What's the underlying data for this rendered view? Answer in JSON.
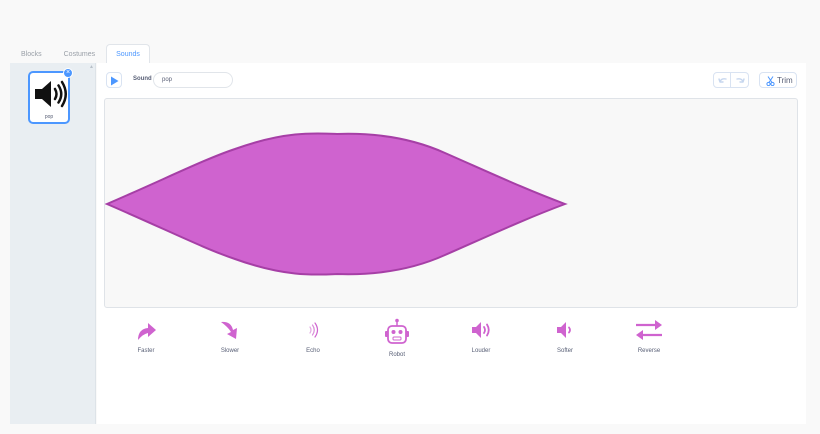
{
  "tabs": [
    {
      "label": "Blocks"
    },
    {
      "label": "Costumes"
    },
    {
      "label": "Sounds",
      "active": true
    }
  ],
  "sound_list": {
    "items": [
      {
        "label": "pop",
        "icon": "speaker-icon",
        "selected": true
      }
    ],
    "delete_badge": "×"
  },
  "editor": {
    "sound_label": "Sound",
    "sound_name": "pop",
    "trim_label": "Trim",
    "waveform_color": "#cf63cf",
    "waveform_stroke": "#a63fa6"
  },
  "effects": [
    {
      "label": "Faster",
      "icon": "faster-icon"
    },
    {
      "label": "Slower",
      "icon": "slower-icon"
    },
    {
      "label": "Echo",
      "icon": "echo-icon"
    },
    {
      "label": "Robot",
      "icon": "robot-icon"
    },
    {
      "label": "Louder",
      "icon": "louder-icon"
    },
    {
      "label": "Softer",
      "icon": "softer-icon"
    },
    {
      "label": "Reverse",
      "icon": "reverse-icon"
    }
  ],
  "colors": {
    "accent": "#4c97ff",
    "effect": "#cf63cf",
    "text": "#575e75"
  }
}
